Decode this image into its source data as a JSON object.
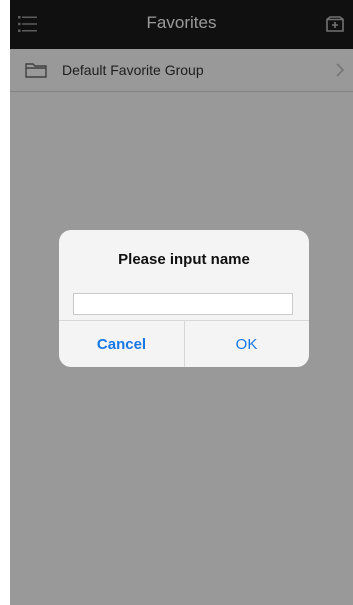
{
  "header": {
    "title": "Favorites",
    "menu_icon": "menu-list-icon",
    "favorite_icon": "favorite-folder-icon"
  },
  "list": {
    "items": [
      {
        "label": "Default Favorite Group",
        "icon": "folder-icon",
        "chevron": "chevron-right-icon"
      }
    ]
  },
  "dialog": {
    "title": "Please input name",
    "input_value": "",
    "cancel_label": "Cancel",
    "ok_label": "OK"
  },
  "colors": {
    "topbar": "#1c1c1c",
    "accent_blue": "#1677e5",
    "overlay": "rgba(0,0,0,0.40)"
  }
}
